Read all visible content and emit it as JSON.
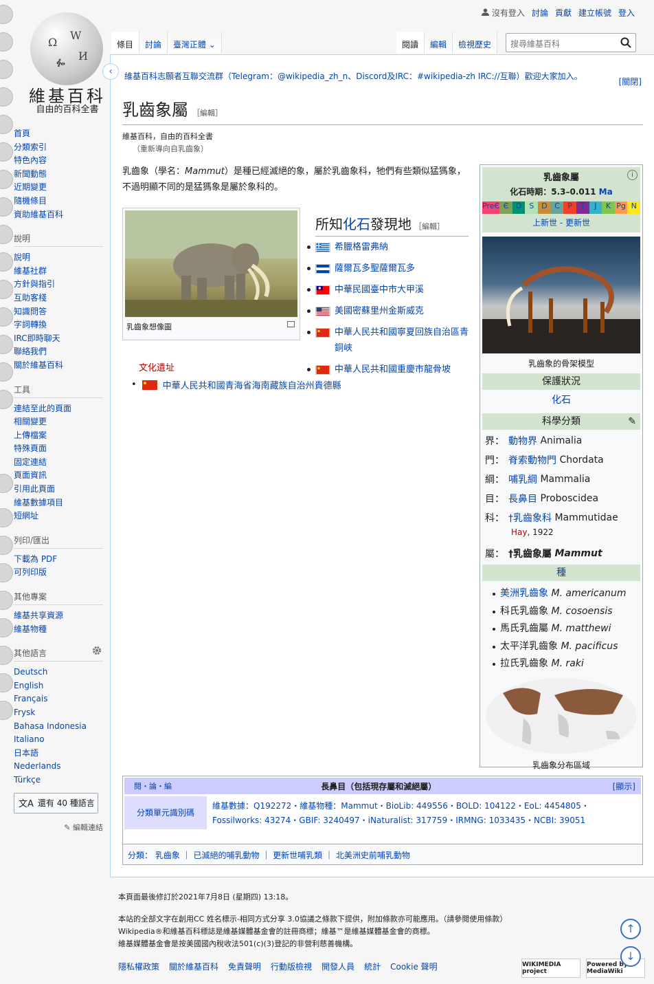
{
  "logo": {
    "wordmark": "維基百科",
    "tagline": "自由的百科全書",
    "glyphs": [
      "Ω",
      "W",
      "И",
      "ᎊ"
    ]
  },
  "personal": {
    "not_logged": "沒有登入",
    "talk": "討論",
    "contrib": "貢獻",
    "create": "建立帳號",
    "login": "登入"
  },
  "tabs_left": [
    "條目",
    "討論",
    "臺灣正體"
  ],
  "tabs_right": [
    "閱讀",
    "編輯",
    "檢視歷史"
  ],
  "search_placeholder": "搜尋維基百科",
  "notice": {
    "text": "維基百科志願者互聯交流群（Telegram：@wikipedia_zh_n、Discord及IRC：#wikipedia-zh IRC://互聯）歡迎大家加入。",
    "close": "[關閉]"
  },
  "title": "乳齒象屬",
  "edit": "［編輯］",
  "tagline": "維基百科，自由的百科全書",
  "redirect": "（重新導向自乳齒象）",
  "lead": {
    "p1": "乳齒象（學名：",
    "sci": "Mammut",
    "p2": "）是種已經滅絕的象，屬於乳齒象科，牠們有些類似猛獁象，不過明顯不同的是猛獁象是屬於象科的。"
  },
  "thumb_caption": "乳齒象想像圖",
  "fossil": {
    "heading_a": "所知",
    "heading_b": "化石",
    "heading_c": "發現地",
    "edit": "［編輯］",
    "sites": [
      {
        "text": "希臘格雷弗納",
        "flag": "greece"
      },
      {
        "text": "薩爾瓦多聖薩爾瓦多",
        "flag": "elsalvador"
      },
      {
        "text": "中華民國臺中市大甲溪",
        "flag": "roc"
      },
      {
        "text": "美國密蘇里州金斯威克",
        "flag": "usa"
      },
      {
        "text": "中華人民共和國寧夏回族自治區青銅峽",
        "flag": "prc"
      },
      {
        "text": "中華人民共和國重慶市龍骨坡",
        "flag": "prc"
      }
    ],
    "culture": "文化遺址",
    "culture_site": "中華人民共和國青海省海南藏族自治州貴德縣"
  },
  "infobox": {
    "title": "乳齒象屬",
    "fossil_label": "化石時期：5.3–0.011",
    "ma": "Ma",
    "timescale": [
      "PreЄ",
      "Є",
      "O",
      "S",
      "D",
      "C",
      "P",
      "T",
      "J",
      "K",
      "Pg",
      "N"
    ],
    "timescale_colors": [
      "#f74370",
      "#7fa056",
      "#009270",
      "#b3e1b6",
      "#cb8c37",
      "#67a599",
      "#f04028",
      "#812b92",
      "#34b2c9",
      "#7fc64e",
      "#fd9a52",
      "#ffe619"
    ],
    "epoch": "上新世 - 更新世",
    "image_caption": "乳齒象的骨架模型",
    "conservation": "保護狀況",
    "status": "化石",
    "classification": "科學分類",
    "ranks": [
      {
        "k": "界：",
        "v": "動物界",
        "l": "Animalia"
      },
      {
        "k": "門：",
        "v": "脊索動物門",
        "l": "Chordata"
      },
      {
        "k": "綱：",
        "v": "哺乳綱",
        "l": "Mammalia"
      },
      {
        "k": "目：",
        "v": "長鼻目",
        "l": "Proboscidea"
      },
      {
        "k": "科：",
        "v": "†乳齒象科",
        "l": "Mammutidae"
      }
    ],
    "author_a": "Hay",
    "author_b": ", 1922",
    "genus_k": "屬：",
    "genus_v": "†乳齒象屬",
    "genus_l": "Mammut",
    "species_hdr": "種",
    "species": [
      {
        "zh": "美洲乳齒象",
        "sci": "M. americanum"
      },
      {
        "zh": "科氏乳齒象",
        "sci": "M. cosoensis"
      },
      {
        "zh": "馬氏乳齒屬",
        "sci": "M. matthewi"
      },
      {
        "zh": "太平洋乳齒象",
        "sci": "M. pacificus"
      },
      {
        "zh": "拉氏乳齒象",
        "sci": "M. raki"
      }
    ],
    "map_caption": "乳齒象分布區域"
  },
  "navbox": {
    "vte": "閱・論・編",
    "title": "長鼻目（包括現存屬和滅絕屬）",
    "show": "[顯示]",
    "group": "分類單元識別碼",
    "line1": "維基數據：Q192272・維基物種：Mammut・BioLib: 449556・BOLD: 104122・EoL: 4454805・",
    "line2": "Fossilworks: 43274・GBIF: 3240497・iNaturalist: 317759・IRMNG: 1033435・NCBI: 39051"
  },
  "categories": {
    "label": "分類：",
    "items": [
      "乳齒象",
      "已滅絕的哺乳動物",
      "更新世哺乳類",
      "北美洲史前哺乳動物"
    ]
  },
  "sidebar": {
    "nav": [
      "首頁",
      "分類索引",
      "特色內容",
      "新聞動態",
      "近期變更",
      "隨機條目",
      "資助維基百科"
    ],
    "help_h": "說明",
    "help": [
      "說明",
      "維基社群",
      "方針與指引",
      "互助客棧",
      "知識問答",
      "字詞轉換",
      "IRC即時聊天",
      "聯絡我們",
      "關於維基百科"
    ],
    "tools_h": "工具",
    "tools": [
      "連結至此的頁面",
      "相關變更",
      "上傳檔案",
      "特殊頁面",
      "固定連結",
      "頁面資訊",
      "引用此頁面",
      "維基數據項目",
      "短網址"
    ],
    "print_h": "列印/匯出",
    "print": [
      "下載為 PDF",
      "可列印版"
    ],
    "other_h": "其他專案",
    "other": [
      "維基共享資源",
      "維基物種"
    ],
    "lang_h": "其他語言",
    "langs": [
      "Deutsch",
      "English",
      "Français",
      "Frysk",
      "Bahasa Indonesia",
      "Italiano",
      "日本語",
      "Nederlands",
      "Türkçe"
    ],
    "lang_btn": "還有 40 種語言",
    "edit_links": "編輯連結"
  },
  "footer": {
    "modified": "本頁面最後修訂於2021年7月8日 (星期四) 13:18。",
    "l1": "本站的全部文字在創用CC 姓名標示-相同方式分享 3.0協議之條款下提供，附加條款亦可能應用。（請參閱使用條款）",
    "l2": "Wikipedia®和維基百科標誌是維基媒體基金會的註冊商標；維基™是維基媒體基金會的商標。",
    "l3": "維基媒體基金會是按美國國內稅收法501(c)(3)登記的非營利慈善機構。",
    "links": [
      "隱私權政策",
      "關於維基百科",
      "免責聲明",
      "行動版檢視",
      "開發人員",
      "統計",
      "Cookie 聲明"
    ],
    "badge1": "WIKIMEDIA project",
    "badge2": "Powered by MediaWiki"
  }
}
